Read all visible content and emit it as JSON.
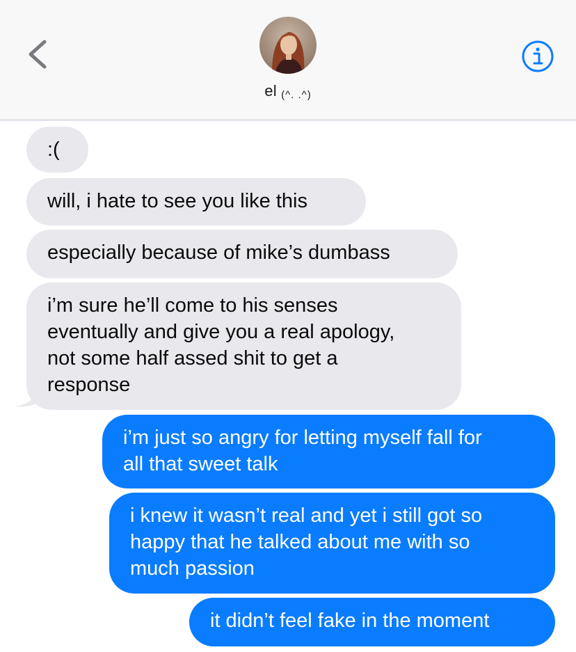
{
  "header": {
    "contact_name": "el",
    "contact_kaomoji": "(^. .^)"
  },
  "colors": {
    "incoming_bubble": "#e9e8ed",
    "outgoing_bubble": "#0a7cff",
    "header_bg": "#f8f8f9",
    "accent": "#0a7cff"
  },
  "icons": {
    "back": "chevron-left-icon",
    "info": "info-icon"
  },
  "messages": [
    {
      "direction": "incoming",
      "lines": [
        ":("
      ]
    },
    {
      "direction": "incoming",
      "lines": [
        "will, i hate to see you like this"
      ]
    },
    {
      "direction": "incoming",
      "lines": [
        "especially because of mike’s dumbass"
      ]
    },
    {
      "direction": "incoming",
      "lines": [
        "i’m sure he’ll come to his senses",
        "eventually and give you a real apology,",
        "not some half assed shit to get a",
        "response"
      ]
    },
    {
      "direction": "outgoing",
      "lines": [
        "i’m just so angry for letting myself fall for",
        "all that sweet talk"
      ]
    },
    {
      "direction": "outgoing",
      "lines": [
        "i knew it wasn’t real and yet i still got so",
        "happy that he talked about me with so",
        "much passion"
      ]
    },
    {
      "direction": "outgoing",
      "lines": [
        "it didn’t feel fake in the moment"
      ]
    }
  ]
}
